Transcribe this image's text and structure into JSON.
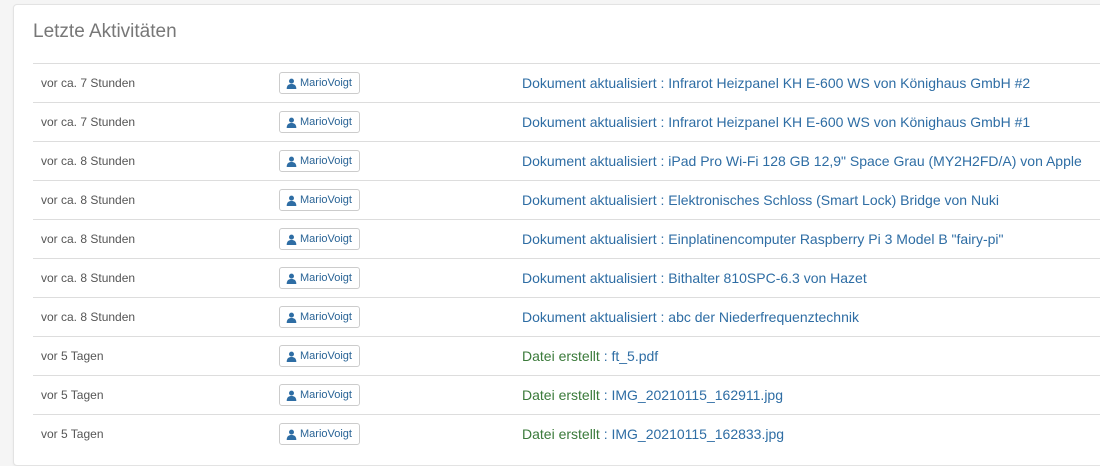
{
  "panel": {
    "title": "Letzte Aktivitäten"
  },
  "colors": {
    "document_text": "#2e6da4",
    "file_created_text": "#3a7a3a",
    "link": "#2e6da4"
  },
  "activities": [
    {
      "time": "vor ca. 7 Stunden",
      "user": "MarioVoigt",
      "type": "Dokument aktualisiert",
      "separator": " : ",
      "target": "Infrarot Heizpanel KH E-600 WS von Könighaus GmbH #2",
      "kind": "doc"
    },
    {
      "time": "vor ca. 7 Stunden",
      "user": "MarioVoigt",
      "type": "Dokument aktualisiert",
      "separator": " : ",
      "target": "Infrarot Heizpanel KH E-600 WS von Könighaus GmbH #1",
      "kind": "doc"
    },
    {
      "time": "vor ca. 8 Stunden",
      "user": "MarioVoigt",
      "type": "Dokument aktualisiert",
      "separator": " : ",
      "target": "iPad Pro Wi-Fi 128 GB 12,9\" Space Grau (MY2H2FD/A) von Apple",
      "kind": "doc"
    },
    {
      "time": "vor ca. 8 Stunden",
      "user": "MarioVoigt",
      "type": "Dokument aktualisiert",
      "separator": " : ",
      "target": "Elektronisches Schloss (Smart Lock) Bridge von Nuki",
      "kind": "doc"
    },
    {
      "time": "vor ca. 8 Stunden",
      "user": "MarioVoigt",
      "type": "Dokument aktualisiert",
      "separator": " : ",
      "target": "Einplatinencomputer Raspberry Pi 3 Model B \"fairy-pi\"",
      "kind": "doc"
    },
    {
      "time": "vor ca. 8 Stunden",
      "user": "MarioVoigt",
      "type": "Dokument aktualisiert",
      "separator": " : ",
      "target": "Bithalter 810SPC-6.3 von Hazet",
      "kind": "doc"
    },
    {
      "time": "vor ca. 8 Stunden",
      "user": "MarioVoigt",
      "type": "Dokument aktualisiert",
      "separator": " : ",
      "target": "abc der Niederfrequenztechnik",
      "kind": "doc"
    },
    {
      "time": "vor 5 Tagen",
      "user": "MarioVoigt",
      "type": "Datei erstellt",
      "separator": " : ",
      "target": "ft_5.pdf",
      "kind": "file"
    },
    {
      "time": "vor 5 Tagen",
      "user": "MarioVoigt",
      "type": "Datei erstellt",
      "separator": " : ",
      "target": "IMG_20210115_162911.jpg",
      "kind": "file"
    },
    {
      "time": "vor 5 Tagen",
      "user": "MarioVoigt",
      "type": "Datei erstellt",
      "separator": " : ",
      "target": "IMG_20210115_162833.jpg",
      "kind": "file"
    }
  ]
}
